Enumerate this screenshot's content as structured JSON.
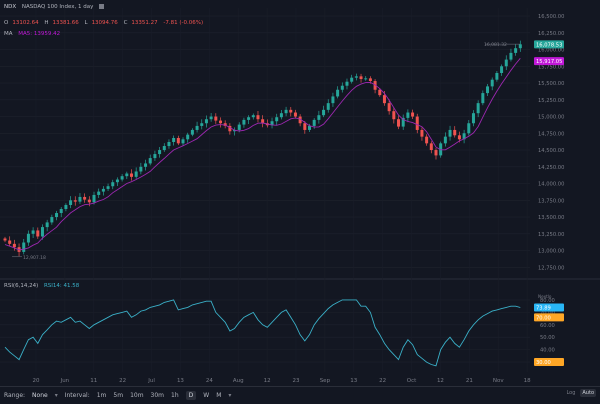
{
  "header": {
    "symbol": "NDX",
    "description": "NASDAQ 100 Index, 1 day",
    "ohlc": {
      "o_label": "O",
      "o": "13102.64",
      "h_label": "H",
      "h": "13381.66",
      "l_label": "L",
      "l": "13094.76",
      "c_label": "C",
      "c": "13351.27",
      "change": "-7.81 (-0.06%)"
    },
    "ma_label": "MA",
    "ma_value": "MA5: 13959.42",
    "rsi_label": "RSI(6,14,24)",
    "rsi_value": "RSI14: 41.58"
  },
  "colors": {
    "up": "#26a69a",
    "down": "#ef5350",
    "ma": "#9c27b0",
    "rsi": "#3ab0c8",
    "price_badge": "#26a69a",
    "ma_badge": "#c018d8",
    "rsi_badge": "#29b6f6",
    "rsi_low_badge": "#ffa726"
  },
  "badges": {
    "price": "16,078.53",
    "ma": "15,917.05",
    "rsi": "73.89",
    "rsi_low": "30.00",
    "rsi_mid": "70.00"
  },
  "annotations": {
    "high": "16,081.32",
    "low": "12,907.18",
    "rsi_tag": "Nextlo"
  },
  "chart_data": {
    "type": "candlestick",
    "y_ticks": [
      "16,500.00",
      "16,250.00",
      "16,000.00",
      "15,750.00",
      "15,500.00",
      "15,250.00",
      "15,000.00",
      "14,750.00",
      "14,500.00",
      "14,250.00",
      "14,000.00",
      "13,750.00",
      "13,500.00",
      "13,250.00",
      "13,000.00",
      "12,750.00"
    ],
    "ylim": [
      12650,
      16620
    ],
    "rsi_ticks": [
      "80.00",
      "70.00",
      "60.00",
      "50.00",
      "40.00",
      "30.00"
    ],
    "rsi_ylim": [
      22,
      88
    ],
    "x_ticks": [
      "20",
      "Jun",
      "11",
      "22",
      "Jul",
      "13",
      "24",
      "Aug",
      "12",
      "23",
      "Sep",
      "13",
      "22",
      "Oct",
      "12",
      "21",
      "Nov",
      "18"
    ],
    "closes": [
      13150,
      13100,
      13050,
      12980,
      13120,
      13250,
      13300,
      13210,
      13350,
      13420,
      13500,
      13560,
      13620,
      13680,
      13750,
      13730,
      13800,
      13760,
      13720,
      13830,
      13880,
      13920,
      13960,
      14020,
      14060,
      14110,
      14150,
      14100,
      14180,
      14250,
      14300,
      14380,
      14440,
      14500,
      14560,
      14620,
      14680,
      14600,
      14660,
      14730,
      14800,
      14860,
      14900,
      14960,
      15000,
      14940,
      14900,
      14860,
      14780,
      14800,
      14880,
      14950,
      14990,
      15020,
      14960,
      14900,
      14870,
      14930,
      14990,
      15050,
      15100,
      15060,
      15000,
      14900,
      14800,
      14860,
      14950,
      15020,
      15100,
      15200,
      15300,
      15400,
      15460,
      15520,
      15580,
      15600,
      15560,
      15570,
      15530,
      15400,
      15320,
      15200,
      15080,
      14960,
      14850,
      14980,
      15060,
      15000,
      14800,
      14700,
      14600,
      14500,
      14420,
      14600,
      14700,
      14800,
      14720,
      14660,
      14750,
      14900,
      15050,
      15200,
      15350,
      15450,
      15550,
      15650,
      15750,
      15850,
      15950,
      16020,
      16078
    ],
    "rsi": [
      42,
      38,
      35,
      32,
      40,
      48,
      50,
      45,
      52,
      56,
      60,
      63,
      62,
      64,
      66,
      62,
      63,
      60,
      57,
      60,
      62,
      64,
      66,
      68,
      69,
      70,
      71,
      66,
      68,
      71,
      72,
      74,
      75,
      76,
      78,
      79,
      80,
      72,
      73,
      74,
      76,
      77,
      78,
      79,
      79,
      70,
      66,
      62,
      55,
      57,
      62,
      66,
      68,
      70,
      64,
      60,
      58,
      62,
      66,
      70,
      72,
      66,
      60,
      52,
      47,
      52,
      60,
      65,
      69,
      73,
      76,
      78,
      80,
      80,
      80,
      80,
      75,
      75,
      70,
      58,
      52,
      45,
      40,
      36,
      32,
      42,
      48,
      44,
      36,
      33,
      30,
      28,
      27,
      40,
      46,
      50,
      45,
      42,
      48,
      55,
      60,
      64,
      67,
      69,
      71,
      72,
      73,
      74,
      75,
      75,
      73.89
    ],
    "ohlc_note": "Daily candlesticks with 5-day moving average overlay"
  },
  "toolbar": {
    "range_label": "Range:",
    "range_value": "None",
    "interval_label": "Interval:",
    "intervals": [
      "1m",
      "5m",
      "10m",
      "30m",
      "1h",
      "D",
      "W",
      "M"
    ],
    "selected": "D",
    "right_a": "Log",
    "right_b": "Auto"
  }
}
